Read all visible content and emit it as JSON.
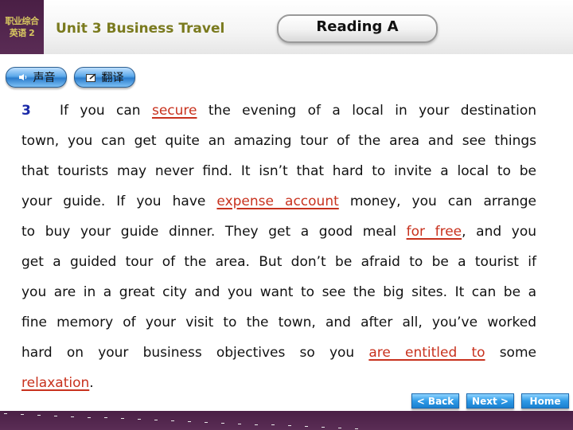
{
  "header": {
    "logo_line1": "职业综合",
    "logo_line2": "英语 2",
    "unit_title": "Unit 3 Business Travel",
    "section_label": "Reading A"
  },
  "toolbar": {
    "sound_icon": "speaker-icon",
    "sound_label": "声音",
    "translate_icon": "edit-note-icon",
    "translate_label": "翻译"
  },
  "passage": {
    "paragraph_number": "3",
    "lines": [
      [
        {
          "t": "If you can "
        },
        {
          "t": "secure",
          "v": true
        },
        {
          "t": " the evening of a local in your destination"
        }
      ],
      [
        {
          "t": "town, you can get quite an amazing tour of the area and see things"
        }
      ],
      [
        {
          "t": "that tourists may never find. It isn’t that hard to invite a local to be"
        }
      ],
      [
        {
          "t": "your guide. If you have "
        },
        {
          "t": "expense account",
          "v": true
        },
        {
          "t": " money, you can arrange"
        }
      ],
      [
        {
          "t": "to buy your guide dinner. They get a good meal "
        },
        {
          "t": "for free",
          "v": true
        },
        {
          "t": ", and you"
        }
      ],
      [
        {
          "t": "get a guided tour of the area. But don’t be afraid to be a tourist if"
        }
      ],
      [
        {
          "t": "you are in a great city and you want to see the big sites. It can be a"
        }
      ],
      [
        {
          "t": "fine memory of your visit to the town, and after all, you’ve worked"
        }
      ],
      [
        {
          "t": "hard on your business objectives so you "
        },
        {
          "t": "are entitled to",
          "v": true
        },
        {
          "t": " some"
        }
      ],
      [
        {
          "t": "relaxation",
          "v": true
        },
        {
          "t": "."
        }
      ]
    ]
  },
  "nav": {
    "back_label": "< Back",
    "next_label": "Next >",
    "home_label": "Home"
  },
  "colors": {
    "brand_purple": "#4a1f45",
    "unit_title": "#7a7a1e",
    "vocab_highlight": "#c8321e",
    "paragraph_number": "#1a2aa8",
    "nav_button": "#2e9ae6"
  }
}
